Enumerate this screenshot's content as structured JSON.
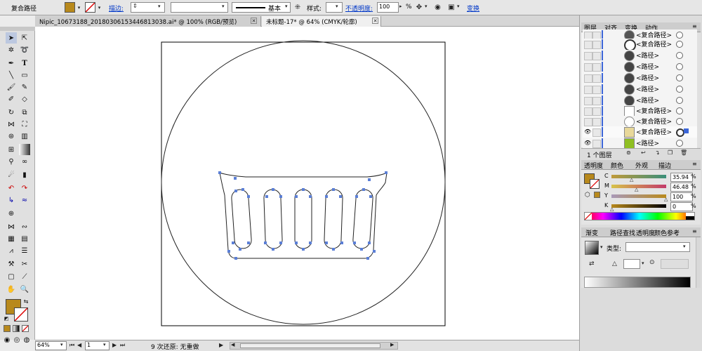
{
  "control_bar": {
    "object_type": "复合路径",
    "stroke_label": "描边:",
    "stroke_style": "基本",
    "style_label": "样式:",
    "opacity_label": "不透明度:",
    "opacity_value": "100",
    "opacity_unit": "%",
    "transform_label": "变换",
    "fill_color": "#b8891c"
  },
  "doc_tabs": [
    {
      "label": "Nipic_10673188_20180306153446813038.ai* @ 100% (RGB/预览)"
    },
    {
      "label": "未标题-17* @ 64% (CMYK/轮廓)"
    }
  ],
  "layers_panel": {
    "tabs": [
      "图层",
      "对齐",
      "变换",
      "动作"
    ],
    "rows": [
      {
        "name": "<复合路径>"
      },
      {
        "name": "<复合路径>"
      },
      {
        "name": "<路径>"
      },
      {
        "name": "<路径>"
      },
      {
        "name": "<路径>"
      },
      {
        "name": "<路径>"
      },
      {
        "name": "<路径>"
      },
      {
        "name": "<复合路径>"
      },
      {
        "name": "<复合路径>"
      },
      {
        "name": "<复合路径>"
      },
      {
        "name": "<路径>"
      }
    ],
    "footer": "1 个图层"
  },
  "color_panel": {
    "tabs": [
      "透明度",
      "颜色",
      "外观",
      "描边"
    ],
    "channels": [
      {
        "label": "C",
        "value": "35.94",
        "level": 0.36
      },
      {
        "label": "M",
        "value": "46.48",
        "level": 0.46
      },
      {
        "label": "Y",
        "value": "100",
        "level": 1.0
      },
      {
        "label": "K",
        "value": "0",
        "level": 0.0
      }
    ],
    "pct": "%"
  },
  "gradient_panel": {
    "tabs": [
      "渐变",
      "路径查找",
      "透明度",
      "颜色参考"
    ],
    "type_label": "类型:"
  },
  "status_bar": {
    "zoom": "64%",
    "artboard": "1",
    "undo_text": "9 次还原: 无重做"
  }
}
